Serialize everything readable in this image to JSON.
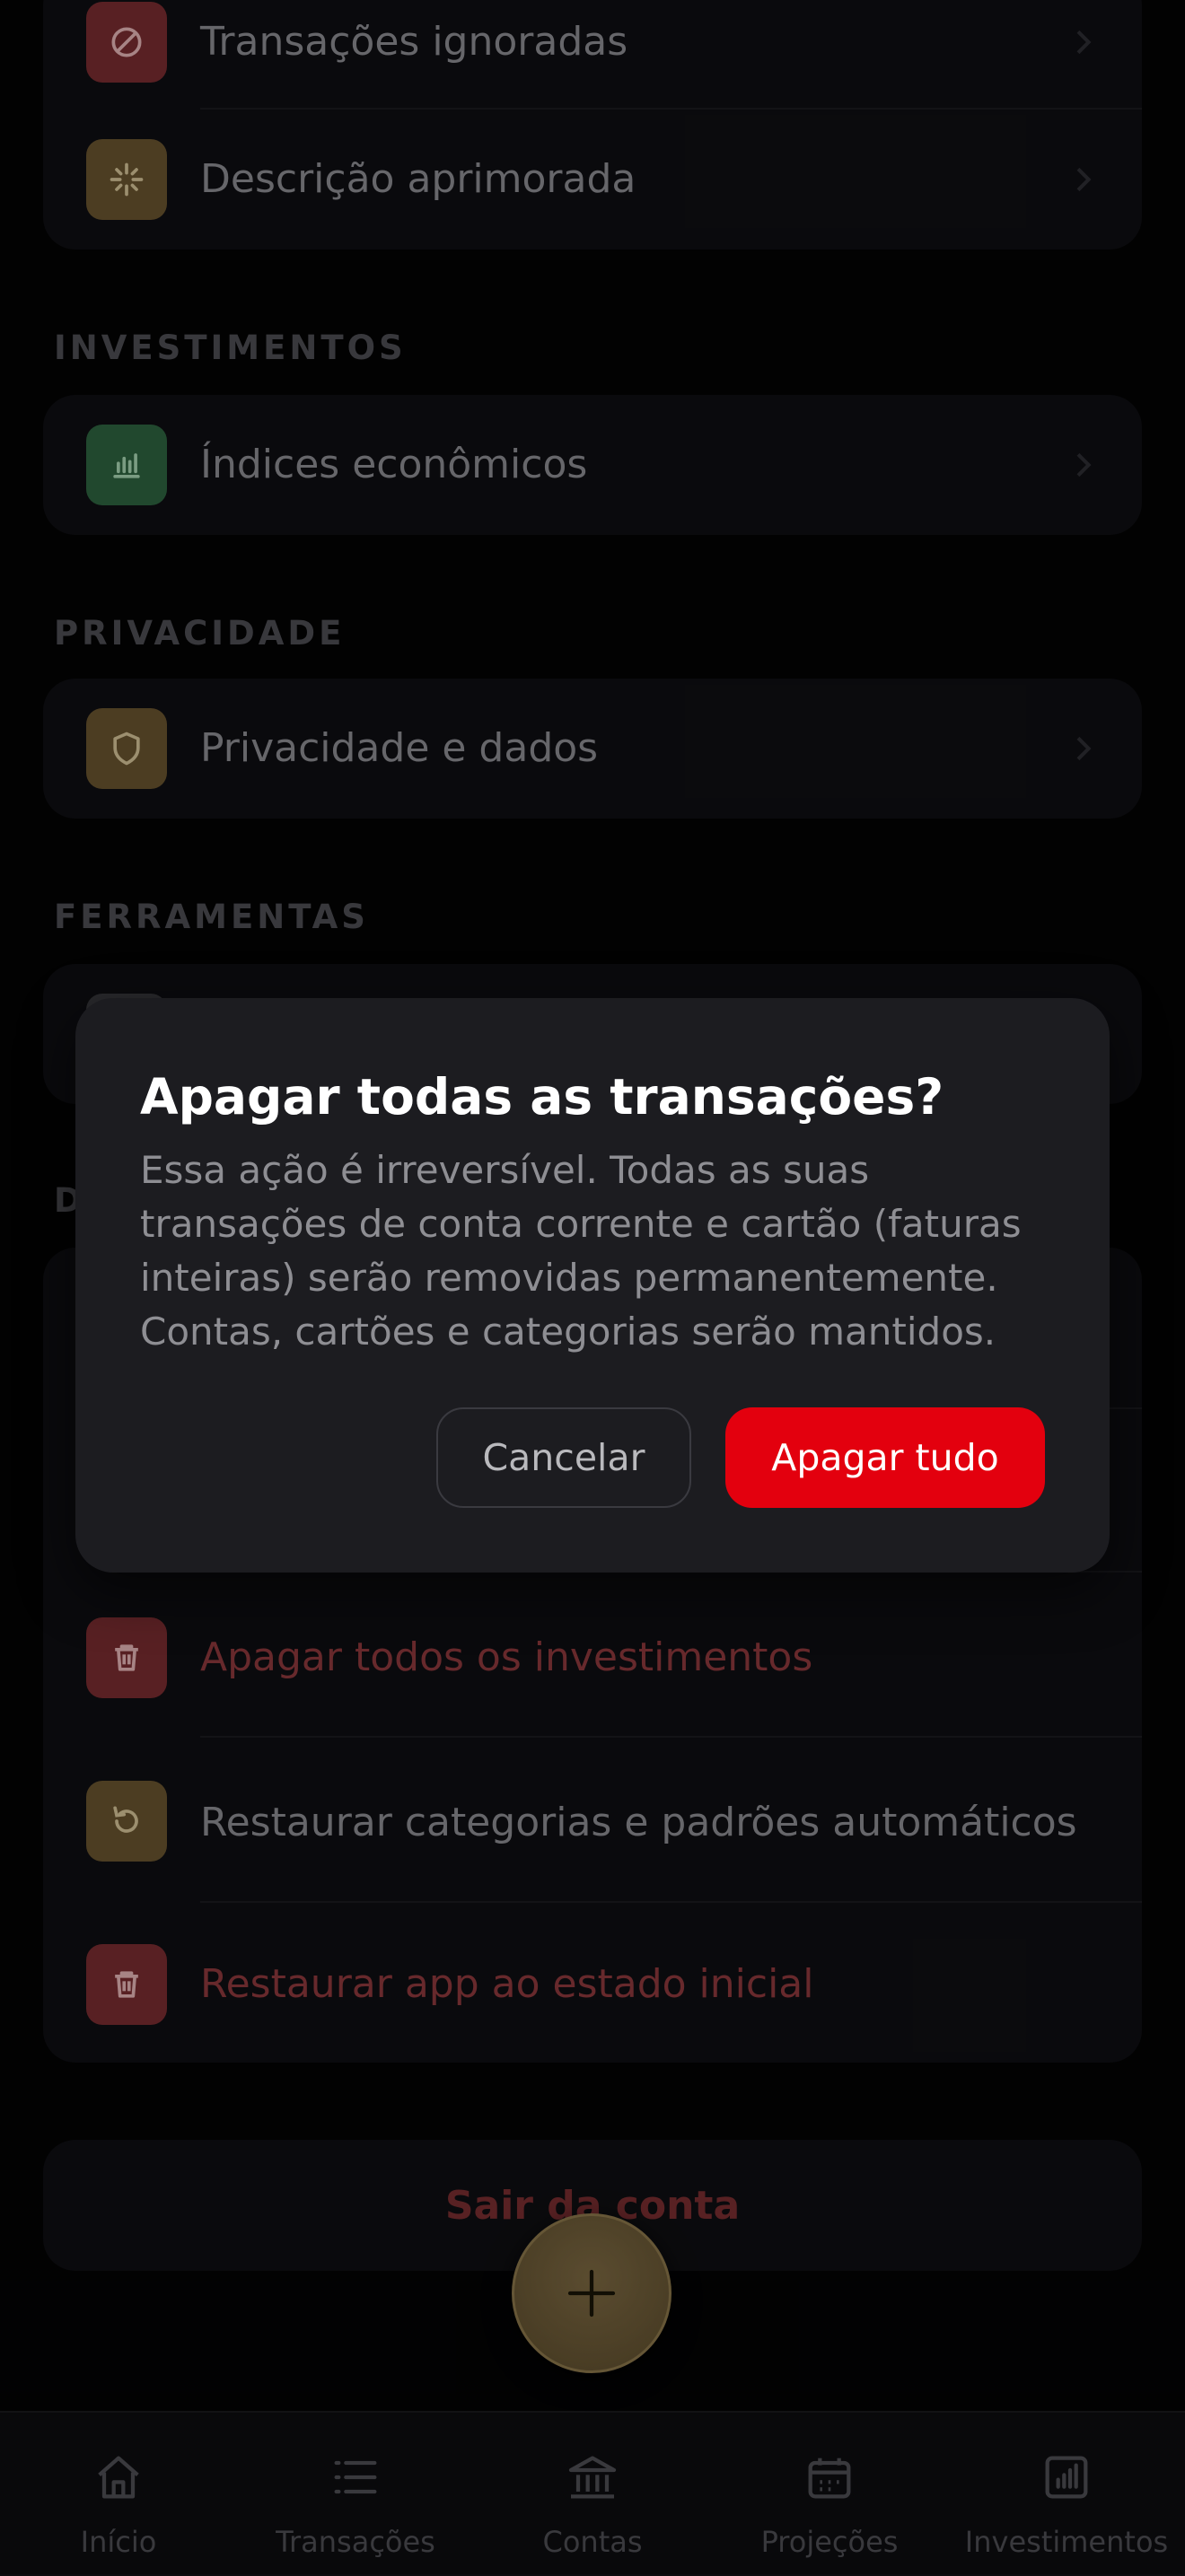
{
  "sections": {
    "investimentos": "INVESTIMENTOS",
    "privacidade": "PRIVACIDADE",
    "ferramentas": "FERRAMENTAS",
    "dados_partial": "D"
  },
  "rows": {
    "transacoes_ignoradas": "Transações ignoradas",
    "descricao_aprimorada": "Descrição aprimorada",
    "indices_economicos": "Índices econômicos",
    "privacidade_dados": "Privacidade e dados",
    "apagar_investimentos": "Apagar todos os investimentos",
    "restaurar_categorias": "Restaurar categorias e padrões automáticos",
    "restaurar_app": "Restaurar app ao estado inicial"
  },
  "logout_label": "Sair da conta",
  "dialog": {
    "title": "Apagar todas as transações?",
    "message": "Essa ação é irreversível. Todas as suas transações de conta corrente e cartão (faturas inteiras) serão removidas permanentemente. Contas, cartões e categorias serão mantidos.",
    "cancel_label": "Cancelar",
    "confirm_label": "Apagar tudo"
  },
  "tabbar": {
    "items": [
      {
        "label": "Início",
        "icon": "home-icon"
      },
      {
        "label": "Transações",
        "icon": "list-icon"
      },
      {
        "label": "Contas",
        "icon": "bank-icon"
      },
      {
        "label": "Projeções",
        "icon": "calendar-icon"
      },
      {
        "label": "Investimentos",
        "icon": "bar-chart-icon"
      }
    ]
  },
  "colors": {
    "background": "#030304",
    "card": "#0f0f12",
    "dialog": "#1c1c20",
    "danger_button": "#e3000e",
    "accent_gold": "#6a5530"
  }
}
